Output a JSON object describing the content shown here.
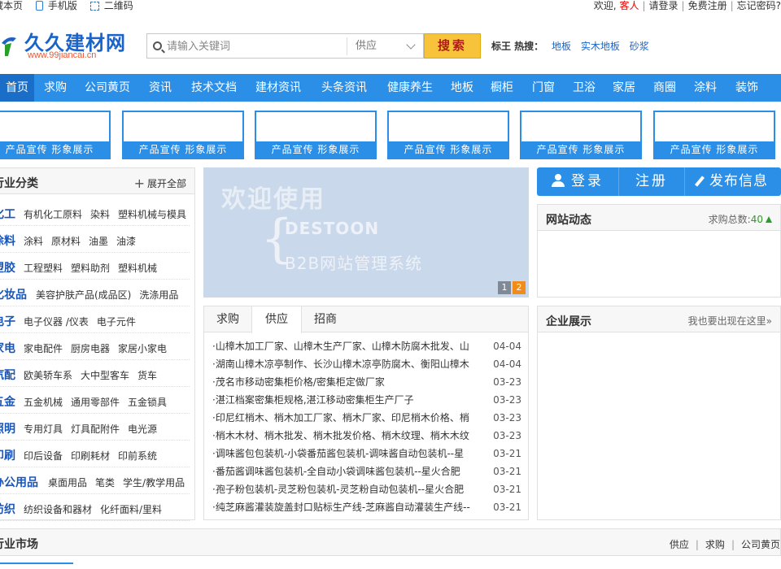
{
  "topbar": {
    "bookmark": "藏本页",
    "mobile": "手机版",
    "qrcode": "二维码",
    "welcome": "欢迎,",
    "guest": "客人",
    "login": "请登录",
    "register": "免费注册",
    "forgot": "忘记密码?"
  },
  "logo": {
    "name": "久久建材网",
    "url": "www.99jiancai.cn"
  },
  "search": {
    "placeholder": "请输入关键词",
    "type": "供应",
    "button": "搜索"
  },
  "hot": {
    "label": "标王 热搜：",
    "links": [
      "地板",
      "实木地板",
      "砂浆"
    ]
  },
  "nav": [
    "首页",
    "求购",
    "公司黄页",
    "资讯",
    "技术文档",
    "建材资讯",
    "头条资讯",
    "健康养生",
    "地板",
    "橱柜",
    "门窗",
    "卫浴",
    "家居",
    "商圈",
    "涂料",
    "装饰"
  ],
  "ads": [
    "产品宣传 形象展示",
    "产品宣传 形象展示",
    "产品宣传 形象展示",
    "产品宣传 形象展示",
    "产品宣传 形象展示",
    "产品宣传 形象展示"
  ],
  "categories": {
    "title": "行业分类",
    "expand": "展开全部",
    "rows": [
      {
        "main": "化工",
        "subs": [
          "有机化工原料",
          "染料",
          "塑料机械与模具"
        ]
      },
      {
        "main": "涂料",
        "subs": [
          "涂料",
          "原材料",
          "油墨",
          "油漆"
        ]
      },
      {
        "main": "塑胶",
        "subs": [
          "工程塑料",
          "塑料助剂",
          "塑料机械"
        ]
      },
      {
        "main": "化妆品",
        "subs": [
          "美容护肤产品(成品区)",
          "洗涤用品"
        ]
      },
      {
        "main": "电子",
        "subs": [
          "电子仪器 /仪表",
          "电子元件"
        ]
      },
      {
        "main": "家电",
        "subs": [
          "家电配件",
          "厨房电器",
          "家居小家电"
        ]
      },
      {
        "main": "汽配",
        "subs": [
          "欧美轿车系",
          "大中型客车",
          "货车"
        ]
      },
      {
        "main": "五金",
        "subs": [
          "五金机械",
          "通用零部件",
          "五金锁具"
        ]
      },
      {
        "main": "照明",
        "subs": [
          "专用灯具",
          "灯具配附件",
          "电光源"
        ]
      },
      {
        "main": "印刷",
        "subs": [
          "印后设备",
          "印刷耗材",
          "印前系统"
        ]
      },
      {
        "main": "办公用品",
        "subs": [
          "桌面用品",
          "笔类",
          "学生/教学用品"
        ]
      },
      {
        "main": "纺织",
        "subs": [
          "纺织设备和器材",
          "化纤面料/里料"
        ]
      }
    ]
  },
  "slide": {
    "line1": "欢迎使用",
    "line2": "DESTOON",
    "line3": "B2B网站管理系统",
    "pages": [
      "1",
      "2"
    ]
  },
  "news": {
    "tabs": [
      "求购",
      "供应",
      "招商"
    ],
    "items": [
      {
        "text": "·山樟木加工厂家、山樟木生产厂家、山樟木防腐木批发、山",
        "date": "04-04"
      },
      {
        "text": "·湖南山樟木凉亭制作、长沙山樟木凉亭防腐木、衡阳山樟木",
        "date": "04-04"
      },
      {
        "text": "·茂名市移动密集柜价格/密集柜定做厂家",
        "date": "03-23"
      },
      {
        "text": "·湛江档案密集柜规格,湛江移动密集柜生产厂子",
        "date": "03-23"
      },
      {
        "text": "·印尼红梢木、梢木加工厂家、梢木厂家、印尼梢木价格、梢",
        "date": "03-23"
      },
      {
        "text": "·梢木木材、梢木批发、梢木批发价格、梢木纹理、梢木木纹",
        "date": "03-23"
      },
      {
        "text": "·调味酱包包装机-小袋番茄酱包装机-调味酱自动包装机--星",
        "date": "03-21"
      },
      {
        "text": "·番茄酱调味酱包装机-全自动小袋调味酱包装机--星火合肥",
        "date": "03-21"
      },
      {
        "text": "·孢子粉包装机-灵芝粉包装机-灵芝粉自动包装机--星火合肥",
        "date": "03-21"
      },
      {
        "text": "·纯芝麻酱灌装旋盖封口贴标生产线-芝麻酱自动灌装生产线--",
        "date": "03-21"
      }
    ]
  },
  "userbar": {
    "login": "登录",
    "register": "注册",
    "publish": "发布信息"
  },
  "dynamics": {
    "title": "网站动态",
    "count_label": "求购总数:",
    "count": "40"
  },
  "showcase": {
    "title": "企业展示",
    "link": "我也要出现在这里»"
  },
  "market": {
    "title": "行业市场",
    "links": [
      "供应",
      "求购",
      "公司黄页"
    ]
  },
  "colors": {
    "brand_blue": "#2b8fe8",
    "search_button": "#f7c33b",
    "accent_orange": "#f18c1a"
  }
}
